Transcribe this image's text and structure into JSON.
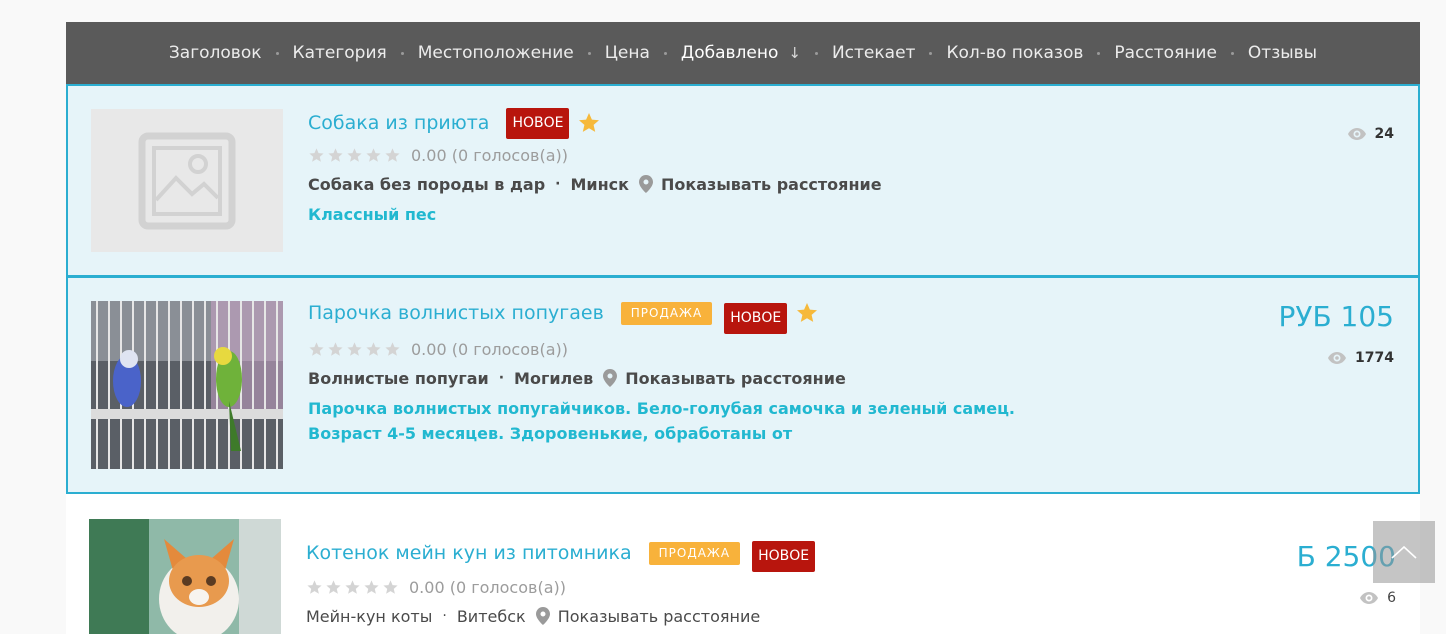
{
  "sortbar": {
    "items": [
      {
        "label": "Заголовок"
      },
      {
        "label": "Категория"
      },
      {
        "label": "Местоположение"
      },
      {
        "label": "Цена"
      },
      {
        "label": "Добавлено",
        "active": true,
        "arrow": "↓"
      },
      {
        "label": "Истекает"
      },
      {
        "label": "Кол-во показов"
      },
      {
        "label": "Расстояние"
      },
      {
        "label": "Отзывы"
      }
    ]
  },
  "listings": [
    {
      "title": "Собака из приюта",
      "badge_new": "НОВОЕ",
      "rating_text": "0.00 (0 голосов(а))",
      "category": "Собака без породы в дар",
      "location": "Минск",
      "distance_label": "Показывать расстояние",
      "description": "Классный пес",
      "views": "24"
    },
    {
      "title": "Парочка волнистых попугаев",
      "badge_sale": "ПРОДАЖА",
      "badge_new": "НОВОЕ",
      "rating_text": "0.00 (0 голосов(а))",
      "category": "Волнистые попугаи",
      "location": "Могилев",
      "distance_label": "Показывать расстояние",
      "description_line1": "Парочка волнистых попугайчиков. Бело-голубая самочка и зеленый самец.",
      "description_line2": "Возраст 4-5 месяцев. Здоровенькие, обработаны от",
      "price": "РУБ 105",
      "views": "1774"
    },
    {
      "title": "Котенок мейн кун из питомника",
      "badge_sale": "ПРОДАЖА",
      "badge_new": "НОВОЕ",
      "rating_text": "0.00 (0 голосов(а))",
      "category": "Мейн-кун коты",
      "location": "Витебск",
      "distance_label": "Показывать расстояние",
      "price": "Ƃ 2500",
      "views": "6"
    }
  ],
  "colors": {
    "accent": "#2baed1",
    "badge_new": "#b8150d",
    "badge_sale": "#f8b23b",
    "sortbar_bg": "#5a5a5a",
    "featured_bg": "#e6f4f9"
  },
  "icons": [
    "image-placeholder-icon",
    "star-icon",
    "pin-icon",
    "eye-icon",
    "chevron-up-icon"
  ]
}
